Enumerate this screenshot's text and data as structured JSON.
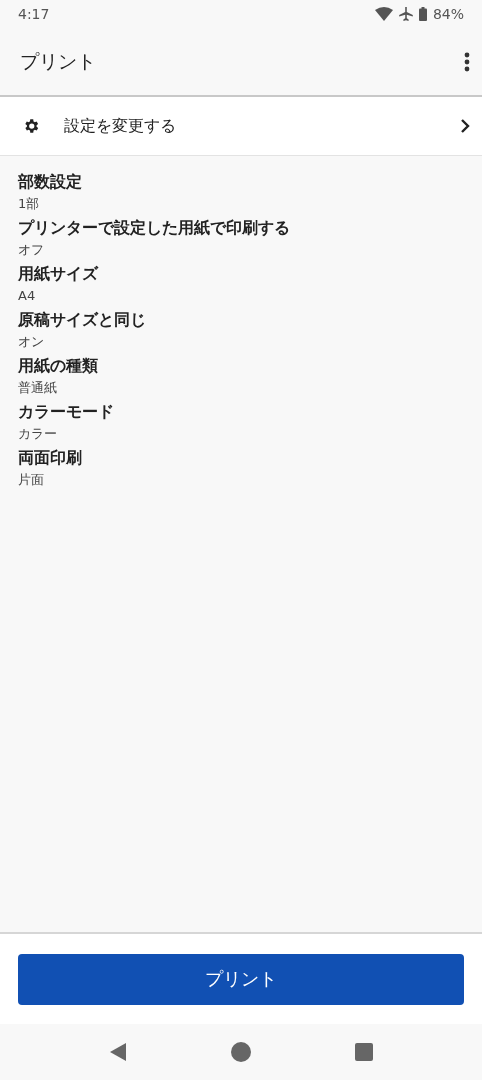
{
  "status_bar": {
    "time": "4:17",
    "battery": "84%"
  },
  "app_bar": {
    "title": "プリント"
  },
  "settings_link": {
    "label": "設定を変更する"
  },
  "settings": [
    {
      "label": "部数設定",
      "value": "1部"
    },
    {
      "label": "プリンターで設定した用紙で印刷する",
      "value": "オフ"
    },
    {
      "label": "用紙サイズ",
      "value": "A4"
    },
    {
      "label": "原稿サイズと同じ",
      "value": "オン"
    },
    {
      "label": "用紙の種類",
      "value": "普通紙"
    },
    {
      "label": "カラーモード",
      "value": "カラー"
    },
    {
      "label": "両面印刷",
      "value": "片面"
    }
  ],
  "print_button": {
    "label": "プリント"
  }
}
